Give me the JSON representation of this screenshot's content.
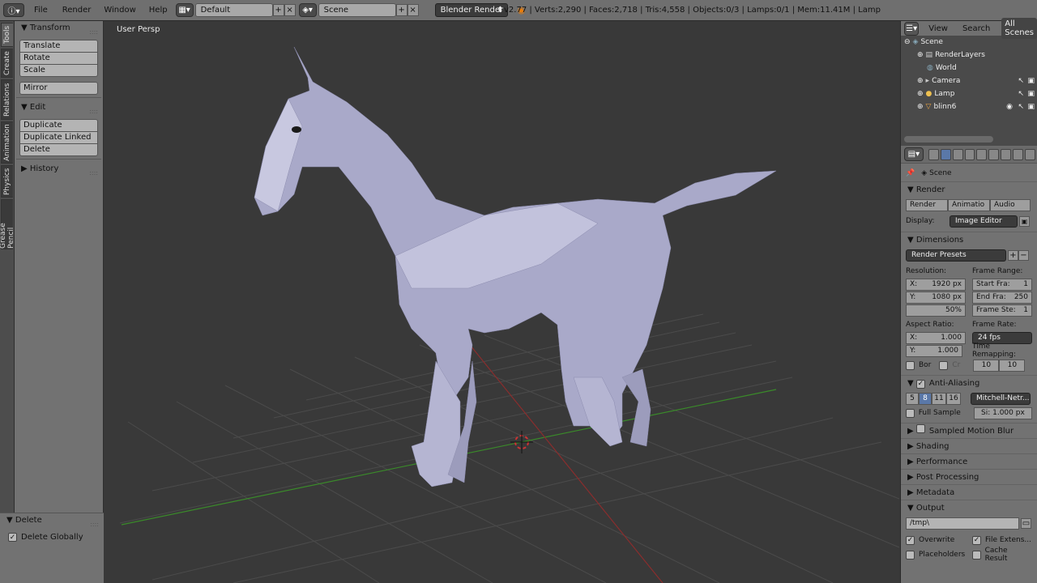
{
  "topbar": {
    "menus": [
      "File",
      "Render",
      "Window",
      "Help"
    ],
    "layout": "Default",
    "scene": "Scene",
    "engine": "Blender Render",
    "stats": "v2.77 | Verts:2,290 | Faces:2,718 | Tris:4,558 | Objects:0/3 | Lamps:0/1 | Mem:11.41M | Lamp"
  },
  "lefttabs": [
    "Tools",
    "Create",
    "Relations",
    "Animation",
    "Physics",
    "Grease Pencil"
  ],
  "tools": {
    "transform": {
      "title": "Transform",
      "buttons": [
        "Translate",
        "Rotate",
        "Scale"
      ],
      "mirror": "Mirror"
    },
    "edit": {
      "title": "Edit",
      "buttons": [
        "Duplicate",
        "Duplicate Linked",
        "Delete"
      ]
    },
    "history": {
      "title": "History"
    }
  },
  "operator": {
    "title": "Delete",
    "option": "Delete Globally"
  },
  "viewport": {
    "label": "User Persp"
  },
  "outliner": {
    "header": {
      "view": "View",
      "search": "Search",
      "filter": "All Scenes"
    },
    "items": [
      "Scene",
      "RenderLayers",
      "World",
      "Camera",
      "Lamp",
      "blinn6"
    ]
  },
  "properties": {
    "context": "Scene",
    "render": {
      "title": "Render",
      "buttons": [
        "Render",
        "Animatio",
        "Audio"
      ],
      "display_label": "Display:",
      "display_value": "Image Editor"
    },
    "dimensions": {
      "title": "Dimensions",
      "presets": "Render Presets",
      "resolution_label": "Resolution:",
      "res_x_label": "X:",
      "res_x": "1920 px",
      "res_y_label": "Y:",
      "res_y": "1080 px",
      "res_pct": "50%",
      "frame_range_label": "Frame Range:",
      "start_label": "Start Fra:",
      "start": "1",
      "end_label": "End Fra:",
      "end": "250",
      "step_label": "Frame Ste:",
      "step": "1",
      "aspect_label": "Aspect Ratio:",
      "asp_x_label": "X:",
      "asp_x": "1.000",
      "asp_y_label": "Y:",
      "asp_y": "1.000",
      "frame_rate_label": "Frame Rate:",
      "fps": "24 fps",
      "time_remap_label": "Time Remapping:",
      "remap_old": "10",
      "remap_new": "10",
      "border": "Bor",
      "crop": "Cr"
    },
    "aa": {
      "title": "Anti-Aliasing",
      "samples": [
        "5",
        "8",
        "11",
        "16"
      ],
      "filter": "Mitchell-Netr...",
      "full_sample": "Full Sample",
      "size": "Si: 1.000 px"
    },
    "collapsed": [
      "Sampled Motion Blur",
      "Shading",
      "Performance",
      "Post Processing",
      "Metadata"
    ],
    "output": {
      "title": "Output",
      "path": "/tmp\\",
      "overwrite": "Overwrite",
      "file_ext": "File Extens...",
      "placeholders": "Placeholders",
      "cache": "Cache Result"
    }
  },
  "colors": {
    "grid_x": "#8a2d2d",
    "grid_y": "#3a8a2a",
    "mesh": "#a9a9c9",
    "accent": "#5a78a8"
  }
}
